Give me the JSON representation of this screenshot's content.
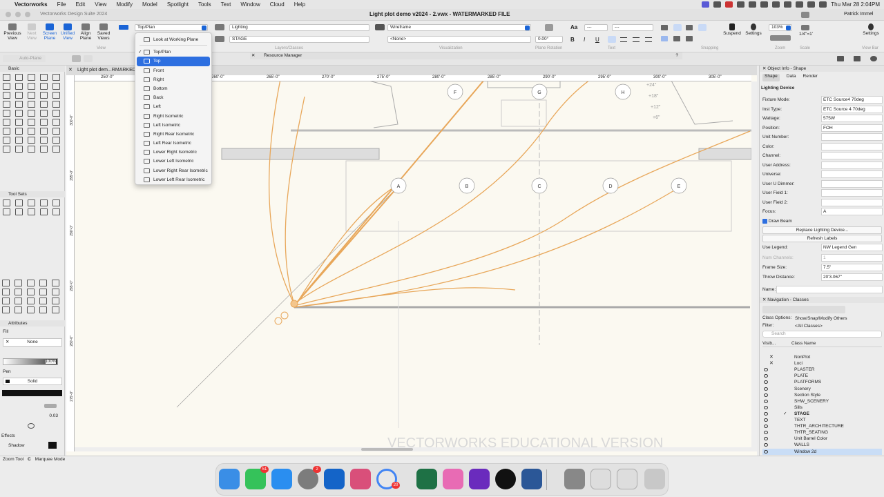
{
  "menubar": {
    "apple": "",
    "app": "Vectorworks",
    "items": [
      "File",
      "Edit",
      "View",
      "Modify",
      "Model",
      "Spotlight",
      "Tools",
      "Text",
      "Window",
      "Cloud",
      "Help"
    ],
    "clock": "Thu Mar 28  2:04PM"
  },
  "titlebar": {
    "suite": "Vectorworks Design Suite 2024",
    "doc": "Light plot demo v2024 - 2.vwx - WATERMARKED FILE",
    "user": "Patrick Immel"
  },
  "toolbar": {
    "previous": "Previous",
    "previous2": "View",
    "next": "Next",
    "next2": "View",
    "screen": "Screen",
    "screen2": "Plane",
    "unified": "Unified",
    "unified2": "View",
    "align": "Align",
    "align2": "Plane",
    "saved": "Saved",
    "saved2": "Views",
    "view_group": "View",
    "view_select": "Top/Plan",
    "class_select": "Lighting",
    "layer_select": "STAGE",
    "layers_group": "Layers/Classes",
    "render_select": "Wireframe",
    "render_select2": "<None>",
    "visualization_group": "Visualization",
    "rotation_value": "0.00°",
    "plane_rotation_group": "Plane Rotation",
    "text_group": "Text",
    "snapping_group": "Snapping",
    "zoom_value": "103%",
    "zoom_group": "Zoom",
    "scale_value": "1/4\"=1'",
    "scale_group": "Scale",
    "suspend": "Suspend",
    "settings": "Settings",
    "settings2": "Settings",
    "viewbar_group": "View Bar",
    "resource_manager": "Resource Manager",
    "autoplane": "Auto-Plane"
  },
  "dropdown": {
    "look": "Look at Working Plane",
    "items": [
      "Top/Plan",
      "Top",
      "Front",
      "Right",
      "Bottom",
      "Back",
      "Left",
      "Right Isometric",
      "Left Isometric",
      "Right Rear Isometric",
      "Left Rear Isometric",
      "Lower Right Isometric",
      "Lower Left Isometric",
      "Lower Right Rear Isometric",
      "Lower Left Rear Isometric"
    ],
    "checked": "Top/Plan",
    "highlighted": "Top"
  },
  "drawing": {
    "tab": "Light plot dem...RMARKED",
    "ruler_marks": [
      "250'-0\"",
      "260'-0\"",
      "265'-0\"",
      "270'-0\"",
      "275'-0\"",
      "280'-0\"",
      "285'-0\"",
      "290'-0\"",
      "295'-0\"",
      "300'-0\"",
      "305'-0\""
    ],
    "vruler_marks": [
      "300'-0\"",
      "295'-0\"",
      "290'-0\"",
      "285'-0\"",
      "280'-0\"",
      "275'-0\""
    ],
    "bubbles_top": [
      "F",
      "G",
      "H"
    ],
    "bubbles_mid": [
      "A",
      "B",
      "C",
      "D",
      "E"
    ],
    "watermark": "VECTORWORKS EDUCATIONAL VERSION",
    "stair_labels": [
      "+24\"",
      "+18\"",
      "+12\"",
      "+6\""
    ]
  },
  "palettes": {
    "basic": "Basic",
    "toolsets": "Tool Sets",
    "attributes": "Attributes",
    "fill": "Fill",
    "fill_value": "None",
    "opacity": "100%",
    "pen": "Pen",
    "pen_value": "Solid",
    "line_weight": "0.03",
    "effects": "Effects",
    "shadow": "Shadow"
  },
  "objinfo": {
    "title": "Object Info - Shape",
    "tabs": [
      "Shape",
      "Data",
      "Render"
    ],
    "type": "Lighting Device",
    "fields": [
      [
        "Fixture Mode:",
        "ETC Source4 70deg"
      ],
      [
        "Inst Type:",
        "ETC Source 4 70deg"
      ],
      [
        "Wattage:",
        "575W"
      ],
      [
        "Position:",
        "FOH"
      ],
      [
        "Unit Number:",
        ""
      ],
      [
        "Color:",
        ""
      ],
      [
        "Channel:",
        ""
      ],
      [
        "User Address:",
        ""
      ],
      [
        "Universe:",
        ""
      ],
      [
        "User U Dimmer:",
        ""
      ],
      [
        "User Field 1:",
        ""
      ],
      [
        "User Field 2:",
        ""
      ],
      [
        "Focus:",
        "A"
      ]
    ],
    "draw_beam": "Draw Beam",
    "replace": "Replace Lighting Device...",
    "refresh": "Refresh Labels",
    "use_legend": "Use Legend:",
    "use_legend_val": "NW Legend Gen",
    "num_channels": "Num Channels:",
    "num_channels_val": "1",
    "frame_size": "Frame Size:",
    "frame_size_val": "7.5\"",
    "throw": "Throw Distance:",
    "throw_val": "20'3.067\"",
    "name": "Name:"
  },
  "navigation": {
    "title": "Navigation - Classes",
    "options_label": "Class Options:",
    "options_val": "Show/Snap/Modify Others",
    "filter_label": "Filter:",
    "filter_val": "<All Classes>",
    "search_placeholder": "Search",
    "col_vis": "Visib...",
    "col_name": "Class Name",
    "rows": [
      {
        "name": "NonPlot",
        "x": true
      },
      {
        "name": "Loci",
        "x": true
      },
      {
        "name": "PLASTER"
      },
      {
        "name": "PLATE"
      },
      {
        "name": "PLATFORMS"
      },
      {
        "name": "Scenery"
      },
      {
        "name": "Section Style"
      },
      {
        "name": "SHW_SCENERY"
      },
      {
        "name": "Sills"
      },
      {
        "name": "STAGE",
        "bold": true,
        "check": "✓"
      },
      {
        "name": "TEXT"
      },
      {
        "name": "THTR_ARCHITECTURE"
      },
      {
        "name": "THTR_SEATING"
      },
      {
        "name": "Unit Barrel Color"
      },
      {
        "name": "WALLS"
      },
      {
        "name": "Window 2d",
        "sel": true
      }
    ]
  },
  "status": {
    "tool": "Zoom Tool",
    "mode": "Marquee Mode"
  },
  "dock": {
    "badge_messages": "51",
    "badge_settings": "2",
    "badge_chrome": "20"
  }
}
